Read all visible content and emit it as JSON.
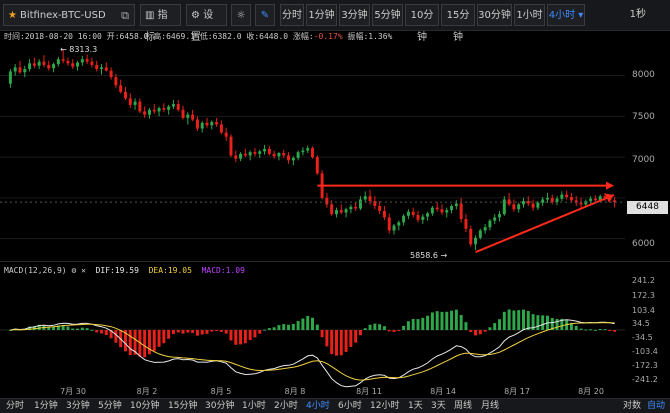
{
  "toolbar": {
    "symbol": "Bitfinex-BTC-USD",
    "indicator_label": "指标",
    "settings_label": "设置",
    "timeframes": [
      "分时",
      "1分钟",
      "3分钟",
      "5分钟",
      "10分钟",
      "15分钟",
      "30分钟",
      "1小时",
      "4小时"
    ],
    "active_timeframe": "4小时",
    "interval_label": "1秒"
  },
  "info_bar": {
    "time": "时间:2018-08-20 16:00",
    "open": "开:6458.0",
    "high": "高:6469.1",
    "low": "低:6382.0",
    "close": "收:6448.0",
    "change_label": "涨幅:",
    "change_value": "-0.17%",
    "amplitude": "振幅:1.36%"
  },
  "annotations": {
    "high_marker": "← 8313.3",
    "low_marker": "5858.6 →"
  },
  "price_axis": {
    "ticks": [
      "8000",
      "7500",
      "7000",
      "6500",
      "6000"
    ],
    "last_price": "6448"
  },
  "macd": {
    "name": "MACD(12,26,9)",
    "dif": "DIF:19.59",
    "dea": "DEA:19.05",
    "macd": "MACD:1.09",
    "ticks": [
      "241.2",
      "172.3",
      "103.4",
      "34.5",
      "-34.5",
      "-103.4",
      "-172.3",
      "-241.2"
    ]
  },
  "x_axis": [
    "7月 30",
    "8月 2",
    "8月 5",
    "8月 8",
    "8月 11",
    "8月 14",
    "8月 17",
    "8月 20"
  ],
  "bottom_bar": {
    "timeframes": [
      "分时",
      "1分钟",
      "3分钟",
      "5分钟",
      "10分钟",
      "15分钟",
      "30分钟",
      "1小时",
      "2小时",
      "4小时",
      "6小时",
      "12小时",
      "1天",
      "3天",
      "周线",
      "月线"
    ],
    "active": "4小时",
    "right_items": [
      "对数",
      "自动"
    ]
  },
  "colors": {
    "up": "#2ea84a",
    "down": "#e8211a",
    "dif": "#e8e8e8",
    "dea": "#f0d040",
    "trend": "#ff2a1a"
  },
  "chart_data": {
    "type": "candlestick",
    "symbol": "Bitfinex-BTC-USD",
    "interval": "4h",
    "date_ticks": [
      "7月 30",
      "8月 2",
      "8月 5",
      "8月 8",
      "8月 11",
      "8月 14",
      "8月 17",
      "8月 20"
    ],
    "price_range": [
      5750,
      8350
    ],
    "high_marker": 8313.3,
    "low_marker": 5858.6,
    "last_close": 6448,
    "candles": [
      [
        7900,
        8080,
        7850,
        8050
      ],
      [
        8050,
        8140,
        8000,
        8100
      ],
      [
        8100,
        8180,
        8020,
        8040
      ],
      [
        8040,
        8120,
        7980,
        8080
      ],
      [
        8080,
        8200,
        8050,
        8150
      ],
      [
        8150,
        8220,
        8090,
        8120
      ],
      [
        8120,
        8200,
        8080,
        8170
      ],
      [
        8170,
        8250,
        8100,
        8130
      ],
      [
        8130,
        8180,
        8060,
        8090
      ],
      [
        8090,
        8160,
        8040,
        8140
      ],
      [
        8140,
        8230,
        8110,
        8200
      ],
      [
        8200,
        8313,
        8150,
        8180
      ],
      [
        8180,
        8220,
        8120,
        8150
      ],
      [
        8150,
        8200,
        8080,
        8110
      ],
      [
        8110,
        8180,
        8060,
        8160
      ],
      [
        8160,
        8240,
        8120,
        8200
      ],
      [
        8200,
        8260,
        8140,
        8170
      ],
      [
        8170,
        8220,
        8100,
        8130
      ],
      [
        8130,
        8180,
        8050,
        8080
      ],
      [
        8080,
        8140,
        8010,
        8100
      ],
      [
        8100,
        8160,
        8050,
        8060
      ],
      [
        8060,
        8100,
        7950,
        7980
      ],
      [
        7980,
        8020,
        7850,
        7880
      ],
      [
        7880,
        7950,
        7780,
        7800
      ],
      [
        7800,
        7860,
        7700,
        7720
      ],
      [
        7720,
        7780,
        7600,
        7640
      ],
      [
        7640,
        7720,
        7580,
        7680
      ],
      [
        7680,
        7720,
        7540,
        7560
      ],
      [
        7560,
        7620,
        7480,
        7520
      ],
      [
        7520,
        7600,
        7470,
        7580
      ],
      [
        7580,
        7650,
        7530,
        7560
      ],
      [
        7560,
        7620,
        7500,
        7600
      ],
      [
        7600,
        7660,
        7550,
        7580
      ],
      [
        7580,
        7640,
        7520,
        7620
      ],
      [
        7620,
        7700,
        7590,
        7650
      ],
      [
        7650,
        7700,
        7560,
        7580
      ],
      [
        7580,
        7630,
        7460,
        7480
      ],
      [
        7480,
        7550,
        7400,
        7520
      ],
      [
        7520,
        7580,
        7440,
        7460
      ],
      [
        7460,
        7500,
        7320,
        7350
      ],
      [
        7350,
        7440,
        7300,
        7420
      ],
      [
        7420,
        7480,
        7360,
        7390
      ],
      [
        7390,
        7450,
        7340,
        7430
      ],
      [
        7430,
        7480,
        7370,
        7400
      ],
      [
        7400,
        7450,
        7280,
        7300
      ],
      [
        7300,
        7360,
        7200,
        7250
      ],
      [
        7250,
        7280,
        7000,
        7020
      ],
      [
        7020,
        7080,
        6940,
        6980
      ],
      [
        6980,
        7060,
        6950,
        7040
      ],
      [
        7040,
        7100,
        7000,
        7020
      ],
      [
        7020,
        7080,
        6960,
        7060
      ],
      [
        7060,
        7110,
        7010,
        7040
      ],
      [
        7040,
        7090,
        6990,
        7070
      ],
      [
        7070,
        7150,
        7030,
        7100
      ],
      [
        7100,
        7140,
        7020,
        7040
      ],
      [
        7040,
        7080,
        6980,
        7010
      ],
      [
        7010,
        7060,
        6960,
        7050
      ],
      [
        7050,
        7090,
        6990,
        7020
      ],
      [
        7020,
        7060,
        6920,
        6960
      ],
      [
        6960,
        7010,
        6900,
        6990
      ],
      [
        6990,
        7080,
        6960,
        7060
      ],
      [
        7060,
        7120,
        7020,
        7080
      ],
      [
        7080,
        7140,
        7050,
        7110
      ],
      [
        7110,
        7130,
        6980,
        7000
      ],
      [
        7000,
        7020,
        6780,
        6800
      ],
      [
        6800,
        6840,
        6480,
        6500
      ],
      [
        6500,
        6560,
        6380,
        6420
      ],
      [
        6420,
        6470,
        6280,
        6300
      ],
      [
        6300,
        6380,
        6260,
        6350
      ],
      [
        6350,
        6420,
        6300,
        6320
      ],
      [
        6320,
        6380,
        6260,
        6360
      ],
      [
        6360,
        6420,
        6310,
        6390
      ],
      [
        6390,
        6450,
        6340,
        6370
      ],
      [
        6370,
        6520,
        6350,
        6480
      ],
      [
        6480,
        6580,
        6440,
        6520
      ],
      [
        6520,
        6600,
        6420,
        6460
      ],
      [
        6460,
        6520,
        6360,
        6400
      ],
      [
        6400,
        6460,
        6300,
        6340
      ],
      [
        6340,
        6400,
        6230,
        6260
      ],
      [
        6260,
        6310,
        6060,
        6100
      ],
      [
        6100,
        6180,
        6050,
        6160
      ],
      [
        6160,
        6220,
        6100,
        6200
      ],
      [
        6200,
        6300,
        6160,
        6280
      ],
      [
        6280,
        6360,
        6240,
        6330
      ],
      [
        6330,
        6380,
        6260,
        6290
      ],
      [
        6290,
        6340,
        6200,
        6230
      ],
      [
        6230,
        6300,
        6180,
        6270
      ],
      [
        6270,
        6330,
        6220,
        6310
      ],
      [
        6310,
        6400,
        6280,
        6380
      ],
      [
        6380,
        6450,
        6330,
        6360
      ],
      [
        6360,
        6420,
        6290,
        6320
      ],
      [
        6320,
        6380,
        6260,
        6350
      ],
      [
        6350,
        6420,
        6310,
        6400
      ],
      [
        6400,
        6470,
        6360,
        6430
      ],
      [
        6430,
        6500,
        6200,
        6240
      ],
      [
        6240,
        6300,
        6080,
        6120
      ],
      [
        6120,
        6160,
        5900,
        5930
      ],
      [
        5930,
        6040,
        5858.6,
        6010
      ],
      [
        6010,
        6120,
        5990,
        6100
      ],
      [
        6100,
        6180,
        6060,
        6140
      ],
      [
        6140,
        6240,
        6100,
        6220
      ],
      [
        6220,
        6300,
        6180,
        6260
      ],
      [
        6260,
        6340,
        6210,
        6300
      ],
      [
        6300,
        6520,
        6280,
        6480
      ],
      [
        6480,
        6560,
        6400,
        6420
      ],
      [
        6420,
        6480,
        6330,
        6360
      ],
      [
        6360,
        6440,
        6320,
        6420
      ],
      [
        6420,
        6500,
        6380,
        6460
      ],
      [
        6460,
        6520,
        6400,
        6430
      ],
      [
        6430,
        6480,
        6340,
        6380
      ],
      [
        6380,
        6460,
        6350,
        6440
      ],
      [
        6440,
        6510,
        6400,
        6480
      ],
      [
        6480,
        6560,
        6440,
        6500
      ],
      [
        6500,
        6540,
        6420,
        6450
      ],
      [
        6450,
        6520,
        6410,
        6490
      ],
      [
        6490,
        6580,
        6460,
        6540
      ],
      [
        6540,
        6590,
        6480,
        6510
      ],
      [
        6510,
        6560,
        6440,
        6470
      ],
      [
        6470,
        6520,
        6400,
        6440
      ],
      [
        6440,
        6500,
        6380,
        6420
      ],
      [
        6420,
        6480,
        6380,
        6460
      ],
      [
        6460,
        6520,
        6420,
        6490
      ],
      [
        6490,
        6530,
        6440,
        6470
      ],
      [
        6470,
        6540,
        6450,
        6520
      ],
      [
        6520,
        6560,
        6460,
        6500
      ],
      [
        6500,
        6540,
        6440,
        6470
      ],
      [
        6470,
        6510,
        6382,
        6448
      ]
    ]
  }
}
